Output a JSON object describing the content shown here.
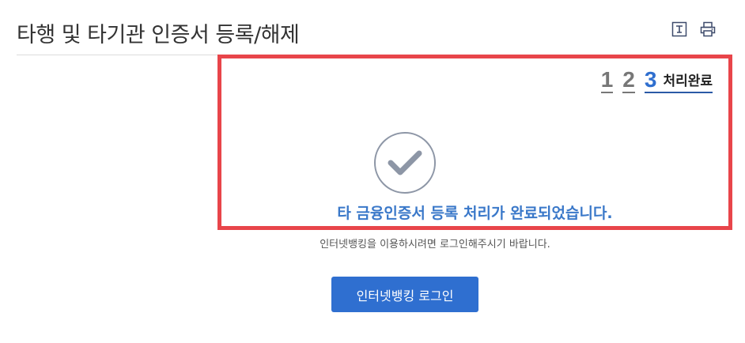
{
  "page": {
    "title": "타행 및 타기관 인증서 등록/해제"
  },
  "header_icons": [
    "text-size-icon",
    "print-icon"
  ],
  "steps": {
    "items": [
      "1",
      "2",
      "3"
    ],
    "current_label": "처리완료"
  },
  "result": {
    "icon": "check-icon",
    "message": "타 금융인증서 등록 처리가 완료되었습니다.",
    "subtext": "인터넷뱅킹을 이용하시려면 로그인해주시기 바랍니다."
  },
  "actions": {
    "login_label": "인터넷뱅킹 로그인"
  },
  "colors": {
    "highlight_border": "#e8454a",
    "accent": "#2f6fd0",
    "message": "#3a78c9"
  }
}
